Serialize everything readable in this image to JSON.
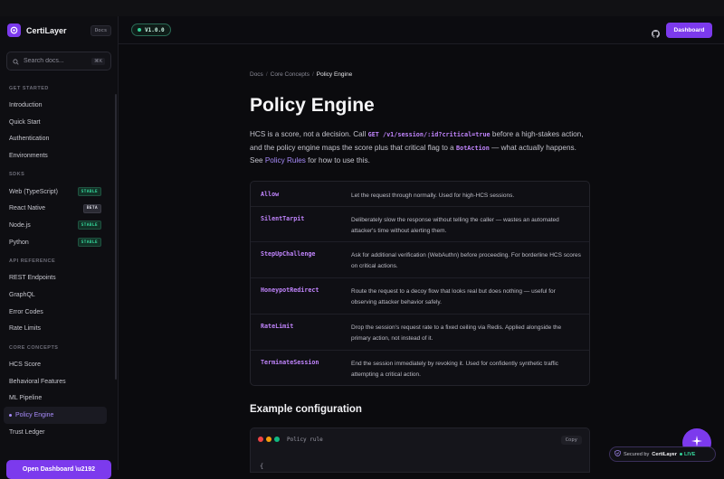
{
  "brand": {
    "name": "CertiLayer",
    "docs_badge": "Docs"
  },
  "search": {
    "placeholder": "Search docs...",
    "shortcut": "⌘K"
  },
  "nav": {
    "sections": [
      {
        "title": "GET STARTED",
        "items": [
          {
            "label": "Introduction"
          },
          {
            "label": "Quick Start"
          },
          {
            "label": "Authentication"
          },
          {
            "label": "Environments"
          }
        ]
      },
      {
        "title": "SDKS",
        "items": [
          {
            "label": "Web (TypeScript)",
            "badge": "STABLE"
          },
          {
            "label": "React Native",
            "badge": "BETA"
          },
          {
            "label": "Node.js",
            "badge": "STABLE"
          },
          {
            "label": "Python",
            "badge": "STABLE"
          }
        ]
      },
      {
        "title": "API REFERENCE",
        "items": [
          {
            "label": "REST Endpoints"
          },
          {
            "label": "GraphQL"
          },
          {
            "label": "Error Codes"
          },
          {
            "label": "Rate Limits"
          }
        ]
      },
      {
        "title": "CORE CONCEPTS",
        "items": [
          {
            "label": "HCS Score"
          },
          {
            "label": "Behavioral Features"
          },
          {
            "label": "ML Pipeline"
          },
          {
            "label": "Policy Engine",
            "active": true
          },
          {
            "label": "Trust Ledger"
          }
        ]
      }
    ],
    "open_dashboard": "Open Dashboard \\u2192"
  },
  "header": {
    "version": "V1.0.0",
    "dashboard": "Dashboard"
  },
  "breadcrumb": {
    "docs": "Docs",
    "section": "Core Concepts",
    "current": "Policy Engine"
  },
  "page": {
    "title": "Policy Engine",
    "intro": {
      "t1": "HCS is a score, not a decision. Call ",
      "code1": "GET /v1/session/:id?critical=true",
      "t2": " before a high-stakes action, and the policy engine maps the score plus that critical flag to a ",
      "code2": "BotAction",
      "t3": " — what actually happens. See ",
      "link": "Policy Rules",
      "t4": " for how to use this."
    },
    "actions": [
      {
        "name": "Allow",
        "desc": "Let the request through normally. Used for high-HCS sessions."
      },
      {
        "name": "SilentTarpit",
        "desc": "Deliberately slow the response without telling the caller — wastes an automated attacker's time without alerting them."
      },
      {
        "name": "StepUpChallenge",
        "desc": "Ask for additional verification (WebAuthn) before proceeding. For borderline HCS scores on critical actions."
      },
      {
        "name": "HoneypotRedirect",
        "desc": "Route the request to a decoy flow that looks real but does nothing — useful for observing attacker behavior safely."
      },
      {
        "name": "RateLimit",
        "desc": "Drop the session's request rate to a fixed ceiling via Redis. Applied alongside the primary action, not instead of it."
      },
      {
        "name": "TerminateSession",
        "desc": "End the session immediately by revoking it. Used for confidently synthetic traffic attempting a critical action."
      }
    ],
    "example_title": "Example configuration",
    "code_label": "Policy rule",
    "copy": "Copy",
    "code_line": "{"
  },
  "secured": {
    "prefix": "Secured by",
    "brand": "CertiLayer",
    "live": "LIVE"
  },
  "colors": {
    "accent": "#7c3aed",
    "code": "#c084fc",
    "live": "#34d399"
  }
}
